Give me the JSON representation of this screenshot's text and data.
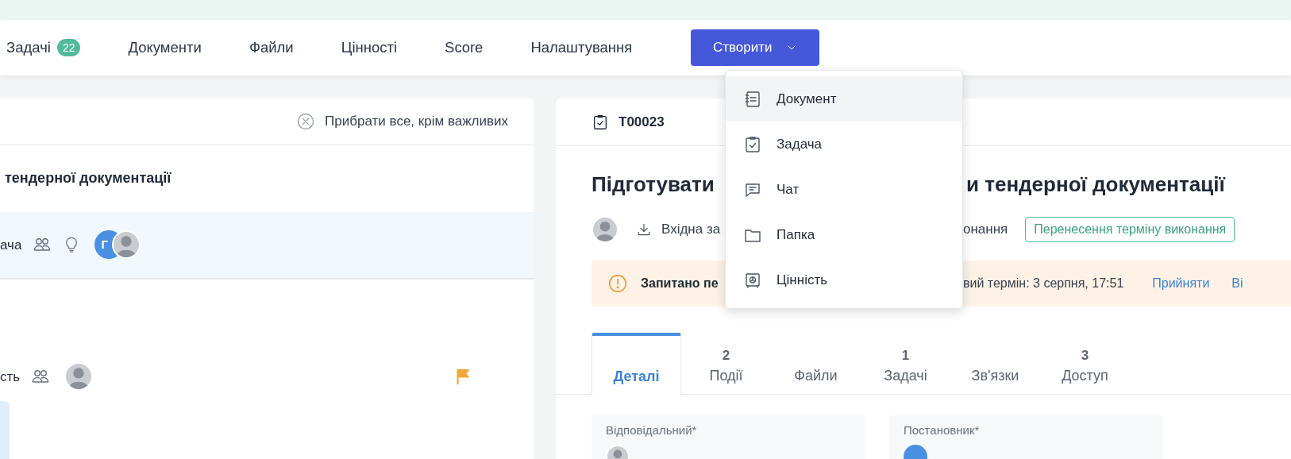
{
  "top_nav": {
    "items": [
      {
        "label": "Задачі",
        "badge": "22"
      },
      {
        "label": "Документи"
      },
      {
        "label": "Файли"
      },
      {
        "label": "Цінності"
      },
      {
        "label": "Score"
      },
      {
        "label": "Налаштування"
      }
    ],
    "create_button": "Створити"
  },
  "create_menu": {
    "items": [
      {
        "kind": "document",
        "label": "Документ",
        "selected": true
      },
      {
        "kind": "task",
        "label": "Задача",
        "selected": false
      },
      {
        "kind": "chat",
        "label": "Чат",
        "selected": false
      },
      {
        "kind": "folder",
        "label": "Папка",
        "selected": false
      },
      {
        "kind": "value",
        "label": "Цінність",
        "selected": false
      }
    ]
  },
  "left_panel": {
    "clear_button": "Прибрати все, крім важливих",
    "title": "тендерної документації",
    "rows": [
      {
        "label": "ача",
        "highlighted": true,
        "bulb": true,
        "initials": "Г",
        "flagged": false
      },
      {
        "label": "сть",
        "highlighted": false,
        "bulb": false,
        "flagged": true
      }
    ]
  },
  "task": {
    "id": "T00023",
    "title_parts": [
      "Підготувати",
      "и тендерної документації"
    ],
    "source_text": "Вхідна за",
    "status_text": "онання",
    "tag": "Перенесення терміну виконання",
    "banner": {
      "bold_text": "Запитано пе",
      "text": "вий термін: 3 серпня, 17:51",
      "actions": [
        "Прийняти",
        "Ві"
      ]
    },
    "tabs": [
      {
        "label": "Деталі",
        "selected": true
      },
      {
        "label": "Події",
        "count": "2",
        "selected": false
      },
      {
        "label": "Файли",
        "selected": false
      },
      {
        "label": "Задачі",
        "count": "1",
        "selected": false
      },
      {
        "label": "Зв'язки",
        "selected": false
      },
      {
        "label": "Доступ",
        "count": "3",
        "selected": false
      }
    ],
    "fields": [
      {
        "label": "Відповідальний*"
      },
      {
        "label": "Постановник*"
      }
    ]
  }
}
